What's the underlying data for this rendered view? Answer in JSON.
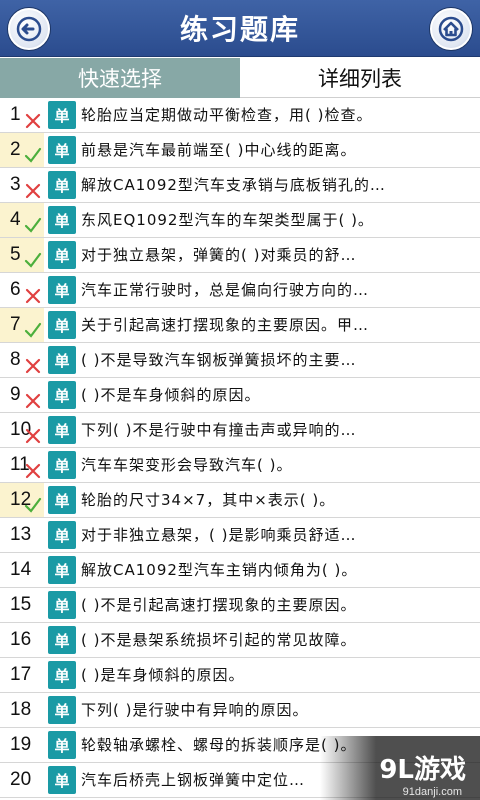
{
  "header": {
    "title": "练习题库",
    "back_icon": "back-arrow-icon",
    "home_icon": "home-icon"
  },
  "tabs": [
    {
      "label": "快速选择",
      "active": false
    },
    {
      "label": "详细列表",
      "active": true
    }
  ],
  "questions": [
    {
      "num": "1",
      "status": "wrong",
      "type": "单",
      "text": "轮胎应当定期做动平衡检查，用( )检查。"
    },
    {
      "num": "2",
      "status": "correct",
      "type": "单",
      "text": "前悬是汽车最前端至( )中心线的距离。"
    },
    {
      "num": "3",
      "status": "wrong",
      "type": "单",
      "text": "解放CA1092型汽车支承销与底板销孔的…"
    },
    {
      "num": "4",
      "status": "correct",
      "type": "单",
      "text": "东风EQ1092型汽车的车架类型属于( )。"
    },
    {
      "num": "5",
      "status": "correct",
      "type": "单",
      "text": "对于独立悬架，弹簧的( )对乘员的舒…"
    },
    {
      "num": "6",
      "status": "wrong",
      "type": "单",
      "text": "汽车正常行驶时，总是偏向行驶方向的…"
    },
    {
      "num": "7",
      "status": "correct",
      "type": "单",
      "text": "关于引起高速打摆现象的主要原因。甲…"
    },
    {
      "num": "8",
      "status": "wrong",
      "type": "单",
      "text": "( )不是导致汽车钢板弹簧损坏的主要…"
    },
    {
      "num": "9",
      "status": "wrong",
      "type": "单",
      "text": "( )不是车身倾斜的原因。"
    },
    {
      "num": "10",
      "status": "wrong",
      "type": "单",
      "text": "下列( )不是行驶中有撞击声或异响的…"
    },
    {
      "num": "11",
      "status": "wrong",
      "type": "单",
      "text": "汽车车架变形会导致汽车( )。"
    },
    {
      "num": "12",
      "status": "correct",
      "type": "单",
      "text": "轮胎的尺寸34×7，其中×表示( )。"
    },
    {
      "num": "13",
      "status": "none",
      "type": "单",
      "text": "对于非独立悬架，( )是影响乘员舒适…"
    },
    {
      "num": "14",
      "status": "none",
      "type": "单",
      "text": "解放CA1092型汽车主销内倾角为( )。"
    },
    {
      "num": "15",
      "status": "none",
      "type": "单",
      "text": "( )不是引起高速打摆现象的主要原因。"
    },
    {
      "num": "16",
      "status": "none",
      "type": "单",
      "text": "( )不是悬架系统损坏引起的常见故障。"
    },
    {
      "num": "17",
      "status": "none",
      "type": "单",
      "text": "( )是车身倾斜的原因。"
    },
    {
      "num": "18",
      "status": "none",
      "type": "单",
      "text": "下列( )是行驶中有异响的原因。"
    },
    {
      "num": "19",
      "status": "none",
      "type": "单",
      "text": "轮毂轴承螺栓、螺母的拆装顺序是( )。"
    },
    {
      "num": "20",
      "status": "none",
      "type": "单",
      "text": "汽车后桥壳上钢板弹簧中定位…"
    }
  ],
  "watermark": {
    "logo": "9L游戏",
    "site": "91danji.com"
  },
  "colors": {
    "header": "#2f5297",
    "tab_quick": "#87a8a6",
    "badge": "#1a9aa5",
    "correct_bg": "#fbf3cf",
    "wrong_mark": "#e04040",
    "correct_mark": "#4caf3c"
  }
}
